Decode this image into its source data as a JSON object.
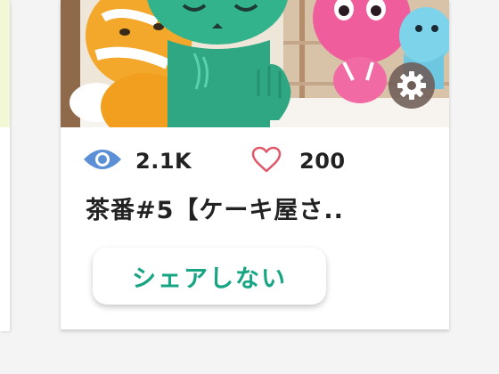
{
  "left_card": {
    "thumb_color": "#f2f7d6"
  },
  "card": {
    "thumbnail": {
      "alt_icon": "cartoon-cats-image"
    },
    "settings": {
      "icon": "gear-icon"
    },
    "stats": {
      "views": {
        "icon": "eye-icon",
        "value": "2.1K",
        "color": "#5b8fd6"
      },
      "likes": {
        "icon": "heart-outline-icon",
        "value": "200",
        "color": "#e0576a"
      }
    },
    "title": "茶番#5【ケーキ屋さ..",
    "share_button": {
      "label": "シェアしない",
      "color": "#17a583"
    }
  }
}
